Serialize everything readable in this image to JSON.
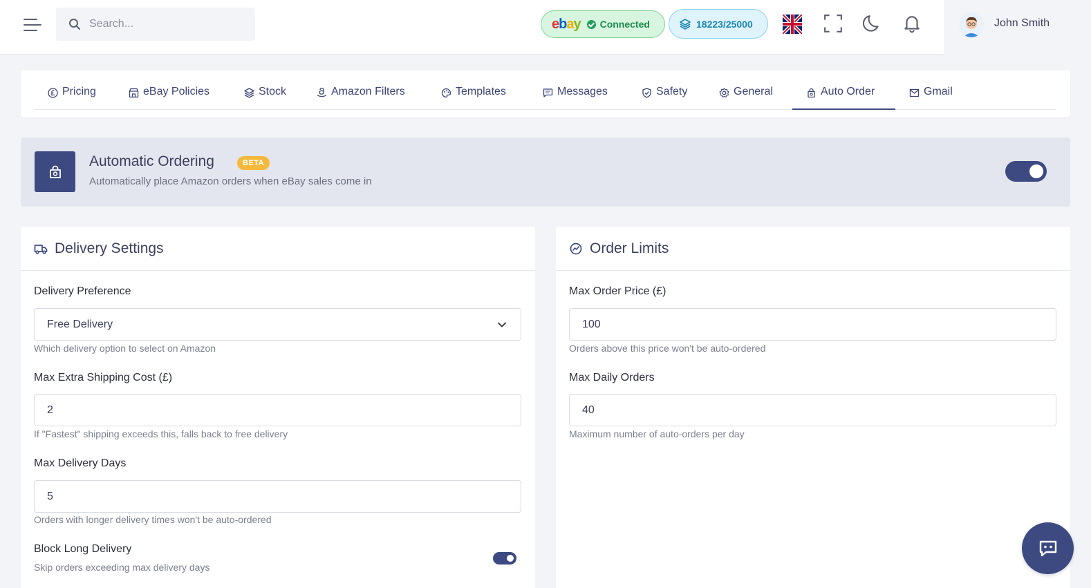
{
  "header": {
    "search_placeholder": "Search...",
    "ebay": {
      "logo_letters": [
        "e",
        "b",
        "a",
        "y"
      ],
      "status": "Connected"
    },
    "credits": "18223/25000",
    "user_name": "John Smith",
    "icons": [
      "menu-icon",
      "search-icon",
      "uk-flag-icon",
      "fullscreen-icon",
      "moon-icon",
      "bell-icon"
    ]
  },
  "tabs": [
    {
      "label": "Pricing",
      "icon": "pound-icon"
    },
    {
      "label": "eBay Policies",
      "icon": "store-icon"
    },
    {
      "label": "Stock",
      "icon": "layers-icon"
    },
    {
      "label": "Amazon Filters",
      "icon": "amazon-icon"
    },
    {
      "label": "Templates",
      "icon": "palette-icon"
    },
    {
      "label": "Messages",
      "icon": "message-icon"
    },
    {
      "label": "Safety",
      "icon": "shield-icon"
    },
    {
      "label": "General",
      "icon": "gear-icon"
    },
    {
      "label": "Auto Order",
      "icon": "cart-icon",
      "active": true
    },
    {
      "label": "Gmail",
      "icon": "mail-icon"
    }
  ],
  "banner": {
    "title": "Automatic Ordering",
    "badge": "BETA",
    "subtitle": "Automatically place Amazon orders when eBay sales come in",
    "enabled": true
  },
  "delivery": {
    "title": "Delivery Settings",
    "preference": {
      "label": "Delivery Preference",
      "value": "Free Delivery",
      "help": "Which delivery option to select on Amazon"
    },
    "max_shipping": {
      "label": "Max Extra Shipping Cost (£)",
      "value": "2",
      "help": "If \"Fastest\" shipping exceeds this, falls back to free delivery"
    },
    "max_days": {
      "label": "Max Delivery Days",
      "value": "5",
      "help": "Orders with longer delivery times won't be auto-ordered"
    },
    "block_long": {
      "label": "Block Long Delivery",
      "help": "Skip orders exceeding max delivery days",
      "enabled": true
    }
  },
  "limits": {
    "title": "Order Limits",
    "max_price": {
      "label": "Max Order Price (£)",
      "value": "100",
      "help": "Orders above this price won't be auto-ordered"
    },
    "max_daily": {
      "label": "Max Daily Orders",
      "value": "40",
      "help": "Maximum number of auto-orders per day"
    }
  },
  "colors": {
    "primary": "#3d4a82",
    "beta": "#f5b83a",
    "connected_bg": "#d7f5df",
    "credits_bg": "#dff3fb"
  }
}
